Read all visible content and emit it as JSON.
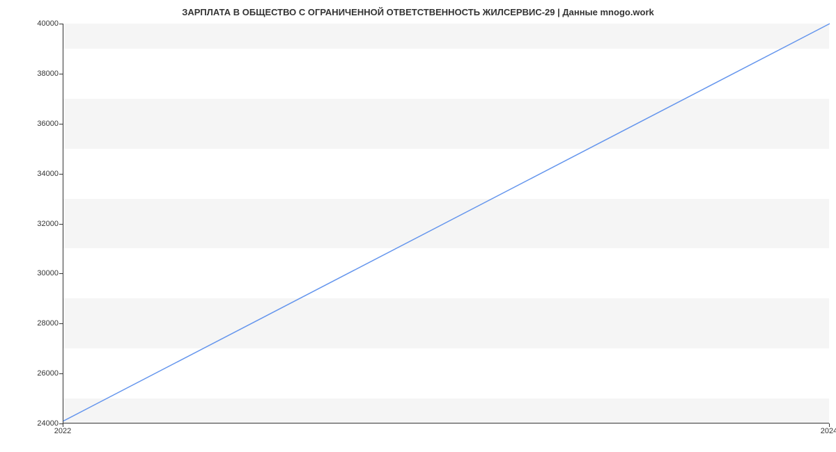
{
  "chart_data": {
    "type": "line",
    "title": "ЗАРПЛАТА В ОБЩЕСТВО С ОГРАНИЧЕННОЙ ОТВЕТСТВЕННОСТЬ ЖИЛСЕРВИС-29 | Данные mnogo.work",
    "x": [
      2022,
      2024
    ],
    "values": [
      24100,
      40000
    ],
    "xlabel": "",
    "ylabel": "",
    "xlim": [
      2022,
      2024
    ],
    "ylim": [
      24000,
      40000
    ],
    "y_ticks": [
      24000,
      26000,
      28000,
      30000,
      32000,
      34000,
      36000,
      38000,
      40000
    ],
    "x_ticks": [
      2022,
      2024
    ],
    "line_color": "#6495ed"
  }
}
